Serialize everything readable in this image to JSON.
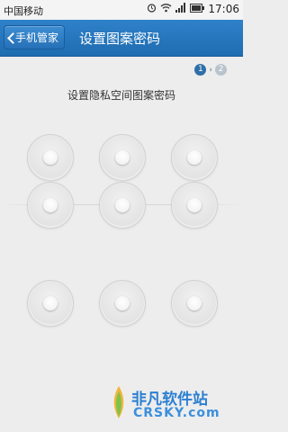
{
  "status_bar": {
    "carrier": "中国移动",
    "time": "17:06",
    "icons": [
      "alarm-icon",
      "wifi-icon",
      "signal-icon",
      "battery-icon"
    ]
  },
  "header": {
    "back_label": "手机管家",
    "title": "设置图案密码"
  },
  "steps": {
    "current": "1",
    "next": "2",
    "arrow": "›",
    "active_color": "#2f6fa8",
    "inactive_color": "#b8c3cc"
  },
  "prompt": "设置隐私空间图案密码",
  "grid": {
    "rows": 3,
    "cols": 3
  },
  "watermark": {
    "title": "非凡软件站",
    "subtitle": "CRSKY.com"
  }
}
